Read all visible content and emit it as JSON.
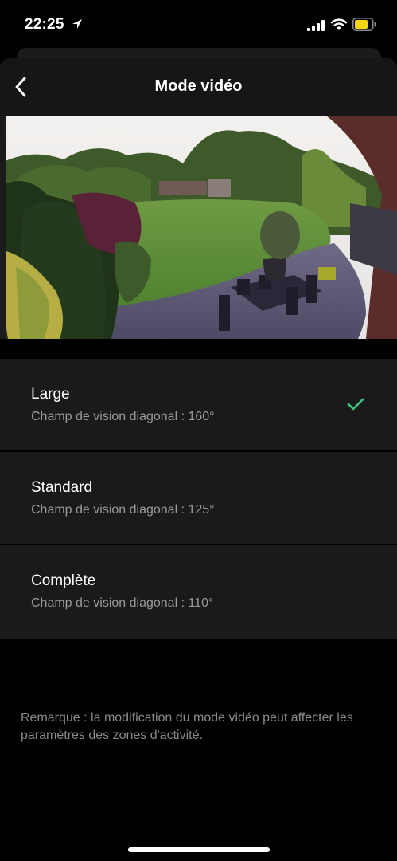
{
  "status_bar": {
    "time": "22:25",
    "icons": [
      "location-arrow-icon",
      "signal-icon",
      "wifi-icon",
      "battery-icon"
    ],
    "battery_color": "#f5d50f"
  },
  "header": {
    "title": "Mode vidéo",
    "back_icon": "chevron-left-icon"
  },
  "options": [
    {
      "title": "Large",
      "subtitle": "Champ de vision diagonal : 160°",
      "selected": true
    },
    {
      "title": "Standard",
      "subtitle": "Champ de vision diagonal : 125°",
      "selected": false
    },
    {
      "title": "Complète",
      "subtitle": "Champ de vision diagonal : 110°",
      "selected": false
    }
  ],
  "check_color": "#3cc483",
  "note": "Remarque : la modification du mode vidéo peut affecter les paramètres des zones d'activité."
}
